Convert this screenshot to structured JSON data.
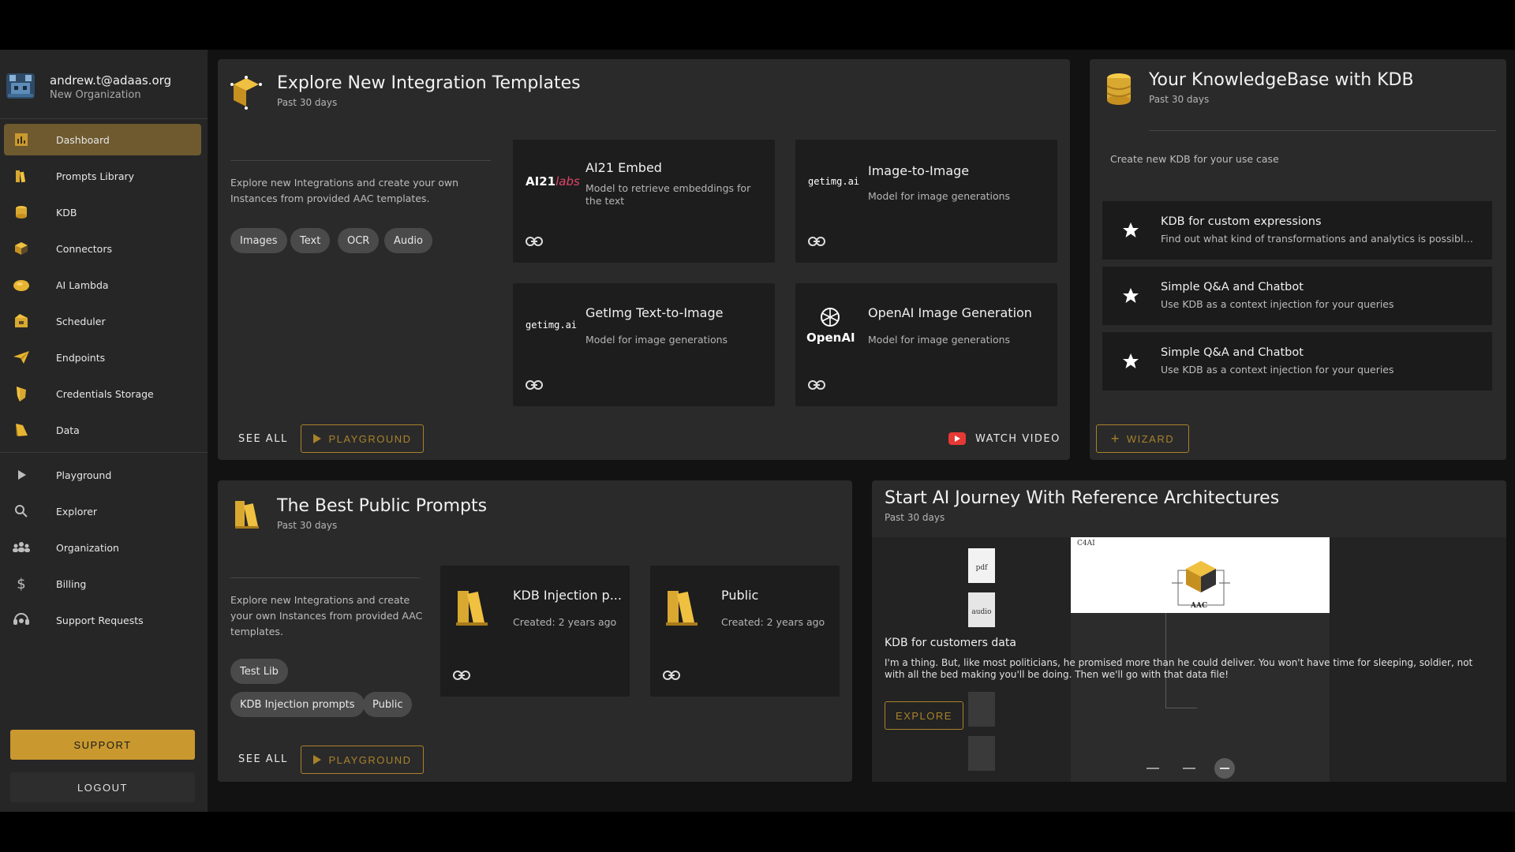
{
  "user": {
    "email": "andrew.t@adaas.org",
    "organization": "New Organization"
  },
  "nav_primary": [
    {
      "label": "Dashboard",
      "icon": "dashboard-icon",
      "active": true
    },
    {
      "label": "Prompts Library",
      "icon": "books-icon"
    },
    {
      "label": "KDB",
      "icon": "coins-icon"
    },
    {
      "label": "Connectors",
      "icon": "cube-icon"
    },
    {
      "label": "AI Lambda",
      "icon": "lambda-icon"
    },
    {
      "label": "Scheduler",
      "icon": "scheduler-icon"
    },
    {
      "label": "Endpoints",
      "icon": "paper-plane-icon"
    },
    {
      "label": "Credentials Storage",
      "icon": "shield-icon"
    },
    {
      "label": "Data",
      "icon": "data-icon"
    }
  ],
  "nav_secondary": [
    {
      "label": "Playground",
      "icon": "play-icon"
    },
    {
      "label": "Explorer",
      "icon": "search-icon"
    },
    {
      "label": "Organization",
      "icon": "group-icon"
    },
    {
      "label": "Billing",
      "icon": "dollar-icon"
    },
    {
      "label": "Support Requests",
      "icon": "support-icon"
    }
  ],
  "sidebar_buttons": {
    "support": "SUPPORT",
    "logout": "LOGOUT"
  },
  "integrations": {
    "title": "Explore New Integration Templates",
    "subtitle": "Past 30 days",
    "description": "Explore new Integrations and create your own Instances from provided AAC templates.",
    "chips": [
      "Images",
      "Text",
      "OCR",
      "Audio"
    ],
    "tiles": [
      {
        "logo": "AI21labs",
        "title": "AI21 Embed",
        "desc": "Model to retrieve embeddings for the text"
      },
      {
        "logo": "getimg.ai",
        "title": "Image-to-Image",
        "desc": "Model for image generations"
      },
      {
        "logo": "getimg.ai",
        "title": "GetImg Text-to-Image",
        "desc": "Model for image generations"
      },
      {
        "logo": "OpenAI",
        "title": "OpenAI Image Generation",
        "desc": "Model for image generations"
      }
    ],
    "see_all": "SEE ALL",
    "playground": "PLAYGROUND",
    "watch_video": "WATCH VIDEO"
  },
  "kdb": {
    "title": "Your KnowledgeBase with KDB",
    "subtitle": "Past 30 days",
    "description": "Create new KDB for your use case",
    "items": [
      {
        "title": "KDB for custom expressions",
        "desc": "Find out what kind of transformations and analytics is possible to r..."
      },
      {
        "title": "Simple Q&A and Chatbot",
        "desc": "Use KDB as a context injection for your queries"
      },
      {
        "title": "Simple Q&A and Chatbot",
        "desc": "Use KDB as a context injection for your queries"
      }
    ],
    "wizard": "WIZARD"
  },
  "prompts": {
    "title": "The Best Public Prompts",
    "subtitle": "Past 30 days",
    "description": "Explore new Integrations and create your own Instances from provided AAC templates.",
    "chips": [
      "Test Lib",
      "KDB Injection prompts",
      "Public"
    ],
    "tiles": [
      {
        "title": "KDB Injection p...",
        "desc": "Created: 2 years ago"
      },
      {
        "title": "Public",
        "desc": "Created: 2 years ago"
      }
    ],
    "see_all": "SEE ALL",
    "playground": "PLAYGROUND"
  },
  "architectures": {
    "title": "Start AI Journey With Reference Architectures",
    "subtitle": "Past 30 days",
    "slide_title": "KDB for customers data",
    "slide_text": "I'm a thing. But, like most politicians, he promised more than he could deliver. You won't have time for sleeping, soldier, not with all the bed making you'll be doing. Then we'll go with that data file!",
    "explore": "EXPLORE",
    "diagram_labels": {
      "brand": "C4AI",
      "hub": "AAC",
      "doc1": "pdf",
      "doc2": "audio"
    }
  },
  "colors": {
    "accent": "#c9992f",
    "active_nav": "#6e5a2e",
    "card_bg": "#2a2a2a",
    "tile_bg": "#1d1d1d"
  }
}
